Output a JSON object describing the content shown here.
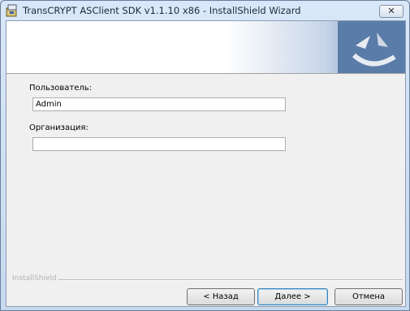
{
  "window": {
    "title": "TransCRYPT ASClient SDK v1.1.10  x86 - InstallShield Wizard",
    "close_glyph": "✕"
  },
  "form": {
    "user": {
      "label": "Пользователь:",
      "value": "Admin"
    },
    "org": {
      "label": "Организация:",
      "value": ""
    }
  },
  "footer": {
    "brand": "InstallShield",
    "back_label": "< Назад",
    "next_label": "Далее >",
    "cancel_label": "Отмена"
  },
  "icons": {
    "app": "installer-icon",
    "banner": "installshield-logo-icon",
    "close": "close-icon"
  },
  "colors": {
    "banner_blue": "#5a7ca8",
    "default_button_border": "#3c7fb1"
  }
}
